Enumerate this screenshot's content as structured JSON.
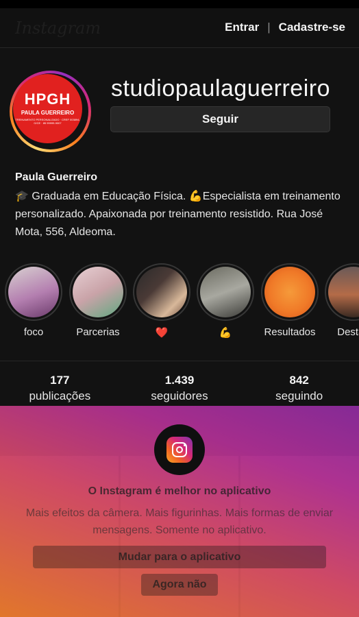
{
  "topbar": {
    "login_label": "Entrar",
    "separator": "|",
    "signup_label": "Cadastre-se"
  },
  "profile": {
    "username": "studiopaulaguerreiro",
    "follow_label": "Seguir",
    "full_name": "Paula Guerreiro",
    "bio": "🎓 Graduada em Educação Física. 💪Especialista em treinamento personalizado. Apaixonada por treinamento resistido. Rua José Mota, 556, Aldeoma.",
    "avatar": {
      "monogram": "HPGH",
      "brand_name": "PAULA GUERREIRO",
      "brand_sub": "TREINAMENTO PERSONALIZADO · CREF 003894-G/CE · 85 99999-9007",
      "color": "#e1211f"
    }
  },
  "highlights": [
    {
      "label": "foco",
      "color": "#b47fb0"
    },
    {
      "label": "Parcerias",
      "color": "#c9a3a8"
    },
    {
      "label": "❤️",
      "color": "#4a3a36"
    },
    {
      "label": "💪",
      "color": "#8a8a80"
    },
    {
      "label": "Resultados",
      "color": "#f07a28"
    },
    {
      "label": "Destaq",
      "color": "#b46b48"
    }
  ],
  "stats": [
    {
      "value": "177",
      "label": "publicações"
    },
    {
      "value": "1.439",
      "label": "seguidores"
    },
    {
      "value": "842",
      "label": "seguindo"
    }
  ],
  "promo": {
    "title": "O Instagram é melhor no aplicativo",
    "text": "Mais efeitos da câmera. Mais figurinhas. Mais formas de enviar mensagens. Somente no aplicativo.",
    "switch_label": "Mudar para o aplicativo",
    "not_now_label": "Agora não"
  },
  "colors": {
    "background": "#121212",
    "overlay_start": "#e97a28",
    "overlay_end": "#8e2ca0"
  }
}
